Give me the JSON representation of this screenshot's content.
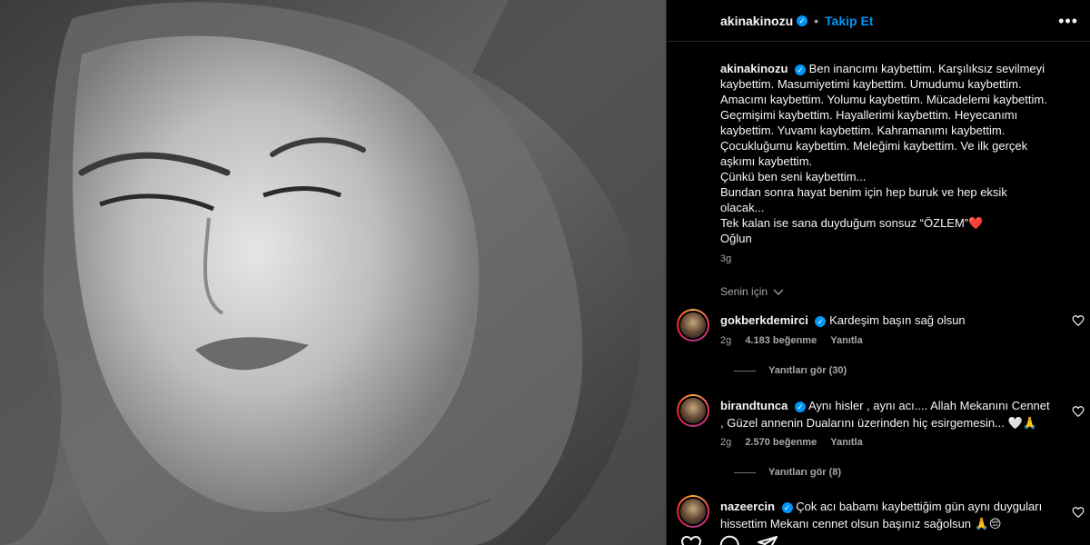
{
  "post": {
    "username": "akinakinozu",
    "follow_label": "Takip Et",
    "separator": "•",
    "more_label": "•••"
  },
  "caption": {
    "username": "akinakinozu",
    "lines": [
      "Ben inancımı kaybettim. Karşılıksız sevilmeyi",
      "kaybettim. Masumiyetimi kaybettim. Umudumu kaybettim.",
      "Amacımı kaybettim. Yolumu kaybettim. Mücadelemi kaybettim.",
      "Geçmişimi kaybettim. Hayallerimi kaybettim. Heyecanımı",
      "kaybettim. Yuvamı kaybettim. Kahramanımı kaybettim.",
      "Çocukluğumu kaybettim. Meleğimi kaybettim. Ve ilk gerçek",
      "aşkımı kaybettim.",
      "Çünkü ben seni kaybettim...",
      "Bundan sonra hayat benim için hep buruk ve hep eksik",
      "olacak...",
      "Tek kalan ise sana duyduğum sonsuz “ÖZLEM”❤️",
      "Oğlun"
    ],
    "time": "3g"
  },
  "translate_label": "Senin için",
  "comments": [
    {
      "username": "gokberkdemirci",
      "text": "Kardeşim başın sağ olsun",
      "time": "2g",
      "likes": "4.183 beğenme",
      "reply": "Yanıtla",
      "view_replies": "Yanıtları gör (30)"
    },
    {
      "username": "birandtunca",
      "text": "Aynı hisler , aynı acı.... Allah Mekanını Cennet",
      "text2": ", Güzel annenin Dualarını üzerinden hiç esirgemesin... 🤍🙏",
      "time": "2g",
      "likes": "2.570 beğenme",
      "reply": "Yanıtla",
      "view_replies": "Yanıtları gör (8)"
    },
    {
      "username": "nazeercin",
      "text": "Çok acı babamı kaybettiğim gün aynı duyguları",
      "text2": "hissettim Mekanı cennet olsun başınız sağolsun 🙏😔"
    }
  ],
  "colors": {
    "accent": "#0095f6",
    "muted": "#a8a8a8",
    "background": "#000000"
  },
  "icons": [
    "verified-icon",
    "heart-icon",
    "chevron-down-icon",
    "like-icon",
    "comment-icon",
    "share-icon"
  ]
}
